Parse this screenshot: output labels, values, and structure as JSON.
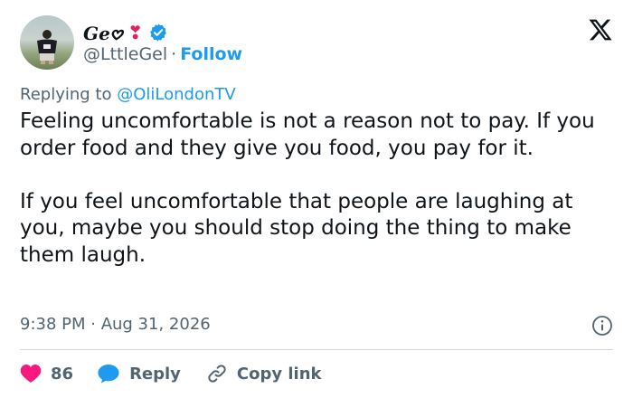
{
  "author": {
    "display_name": "Ge𖹭",
    "heart": "❣",
    "handle": "@LttleGel",
    "separator": "·",
    "follow_label": "Follow"
  },
  "reply_context": {
    "prefix": "Replying to",
    "mention": "@OliLondonTV"
  },
  "tweet": {
    "paragraphs": [
      "Feeling uncomfortable is not a reason not to pay. If you order food and they give you food, you pay for it.",
      "If you feel uncomfortable that people are laughing at you, maybe you should stop doing the thing to make them laugh."
    ],
    "timestamp": "9:38 PM · Aug 31, 2026"
  },
  "actions": {
    "likes_count": "86",
    "reply_label": "Reply",
    "copy_link_label": "Copy link"
  },
  "icons": {
    "brand": "x-logo-icon",
    "verified": "verified-badge-icon",
    "info": "info-icon",
    "like": "heart-icon",
    "reply": "speech-bubble-icon",
    "copy": "link-icon"
  },
  "colors": {
    "accent": "#1d9bf0",
    "like": "#f91880",
    "text": "#0f1419",
    "secondary": "#536471"
  }
}
